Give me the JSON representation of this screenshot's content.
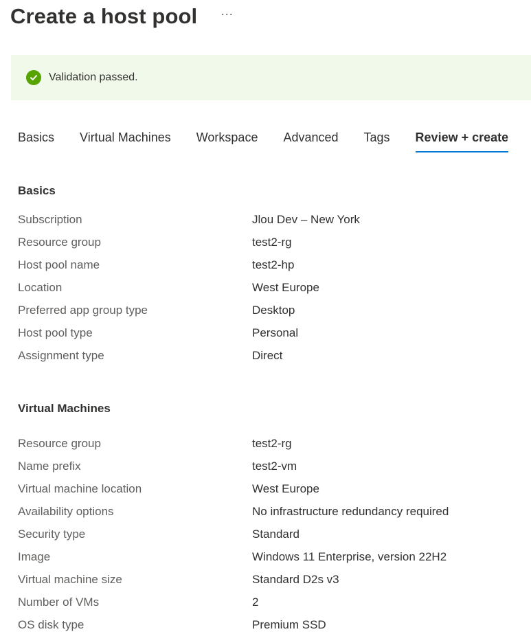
{
  "header": {
    "title": "Create a host pool",
    "more_label": "···"
  },
  "banner": {
    "icon": "check-circle-icon",
    "text": "Validation passed.",
    "color": "#57a300",
    "background": "#f1faea"
  },
  "tabs": [
    {
      "label": "Basics",
      "active": false
    },
    {
      "label": "Virtual Machines",
      "active": false
    },
    {
      "label": "Workspace",
      "active": false
    },
    {
      "label": "Advanced",
      "active": false
    },
    {
      "label": "Tags",
      "active": false
    },
    {
      "label": "Review + create",
      "active": true
    }
  ],
  "accent_color": "#0078d4",
  "basics": {
    "heading": "Basics",
    "rows": [
      {
        "label": "Subscription",
        "value": "Jlou Dev – New York"
      },
      {
        "label": "Resource group",
        "value": "test2-rg"
      },
      {
        "label": "Host pool name",
        "value": "test2-hp"
      },
      {
        "label": "Location",
        "value": "West Europe"
      },
      {
        "label": "Preferred app group type",
        "value": "Desktop"
      },
      {
        "label": "Host pool type",
        "value": "Personal"
      },
      {
        "label": "Assignment type",
        "value": "Direct"
      }
    ]
  },
  "virtual_machines": {
    "heading": "Virtual Machines",
    "rows": [
      {
        "label": "Resource group",
        "value": "test2-rg"
      },
      {
        "label": "Name prefix",
        "value": "test2-vm"
      },
      {
        "label": "Virtual machine location",
        "value": "West Europe"
      },
      {
        "label": "Availability options",
        "value": "No infrastructure redundancy required"
      },
      {
        "label": "Security type",
        "value": "Standard"
      },
      {
        "label": "Image",
        "value": "Windows 11 Enterprise, version 22H2"
      },
      {
        "label": "Virtual machine size",
        "value": "Standard D2s v3"
      },
      {
        "label": "Number of VMs",
        "value": "2"
      },
      {
        "label": "OS disk type",
        "value": "Premium SSD"
      }
    ]
  }
}
